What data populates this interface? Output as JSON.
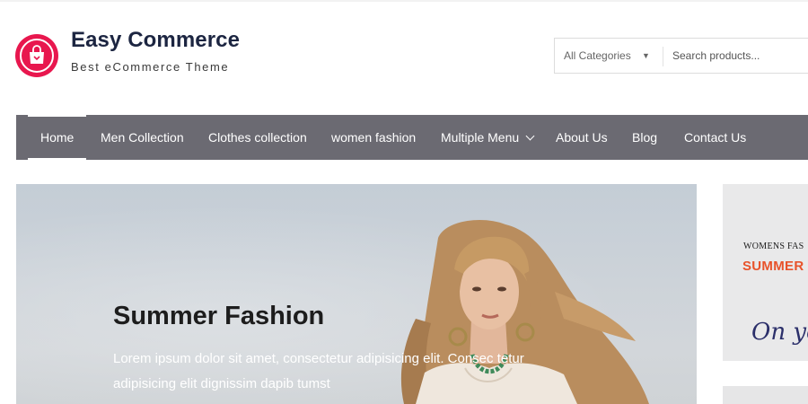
{
  "site": {
    "title": "Easy Commerce",
    "tagline": "Best eCommerce Theme"
  },
  "search": {
    "category_selected": "All Categories",
    "placeholder": "Search products..."
  },
  "nav": {
    "items": [
      {
        "label": "Home"
      },
      {
        "label": "Men Collection"
      },
      {
        "label": "Clothes collection"
      },
      {
        "label": "women fashion"
      },
      {
        "label": "Multiple Menu"
      },
      {
        "label": "About Us"
      },
      {
        "label": "Blog"
      },
      {
        "label": "Contact Us"
      }
    ]
  },
  "hero": {
    "title": "Summer Fashion",
    "text": "Lorem ipsum dolor sit amet, consectetur adipisicing elit. Consec tetur adipisicing elit dignissim dapib tumst"
  },
  "side_banner": {
    "small_text": "WOMENS FAS",
    "big_text": "SUMMER",
    "script_text": "On yo"
  },
  "colors": {
    "brand": "#e8174e",
    "nav_bg": "#6b6a72",
    "title": "#1c2541",
    "accent_orange": "#e8532b"
  },
  "icons": {
    "logo": "shopping-bag-icon",
    "caret": "caret-down-icon",
    "chevron": "chevron-down-icon"
  }
}
